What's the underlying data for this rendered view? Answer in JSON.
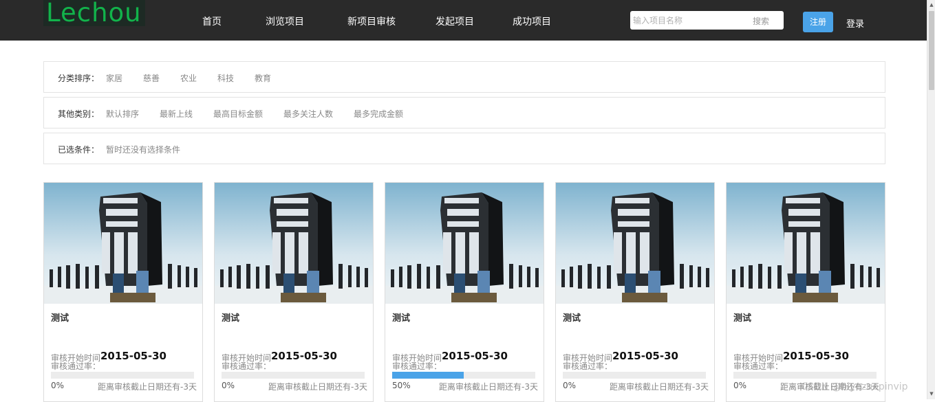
{
  "header": {
    "logo_text": "Lechou",
    "nav": [
      {
        "label": "首页"
      },
      {
        "label": "浏览项目"
      },
      {
        "label": "新项目审核"
      },
      {
        "label": "发起项目"
      },
      {
        "label": "成功项目"
      }
    ],
    "search": {
      "placeholder": "输入项目名称",
      "value": "",
      "button_label": "搜索"
    },
    "register_label": "注册",
    "login_label": "登录"
  },
  "filters": {
    "category": {
      "label": "分类排序：",
      "options": [
        "家居",
        "慈善",
        "农业",
        "科技",
        "教育"
      ]
    },
    "other": {
      "label": "其他类别：",
      "options": [
        "默认排序",
        "最新上线",
        "最高目标金额",
        "最多关注人数",
        "最多完成金额"
      ]
    },
    "selected": {
      "label": "已选条件：",
      "value": "暂时还没有选择条件"
    }
  },
  "cards": [
    {
      "title": "测试",
      "start_label": "审核开始时间",
      "start_date": "2015-05-30",
      "rate_label": "审核通过率：",
      "percent_text": "0%",
      "progress": 0,
      "deadline": "距离审核截止日期还有-3天"
    },
    {
      "title": "测试",
      "start_label": "审核开始时间",
      "start_date": "2015-05-30",
      "rate_label": "审核通过率：",
      "percent_text": "0%",
      "progress": 0,
      "deadline": "距离审核截止日期还有-3天"
    },
    {
      "title": "测试",
      "start_label": "审核开始时间",
      "start_date": "2015-05-30",
      "rate_label": "审核通过率：",
      "percent_text": "50%",
      "progress": 0.5,
      "deadline": "距离审核截止日期还有-3天"
    },
    {
      "title": "测试",
      "start_label": "审核开始时间",
      "start_date": "2015-05-30",
      "rate_label": "审核通过率：",
      "percent_text": "0%",
      "progress": 0,
      "deadline": "距离审核截止日期还有-3天"
    },
    {
      "title": "测试",
      "start_label": "审核开始时间",
      "start_date": "2015-05-30",
      "rate_label": "审核通过率：",
      "percent_text": "0%",
      "progress": 0,
      "deadline": "距离审核截止日期还有-3天"
    }
  ],
  "watermark": "CSDN @biyezuopinvip",
  "colors": {
    "header_bg": "#2a2a2a",
    "logo_green": "#12b34b",
    "accent_blue": "#4aa3e8"
  }
}
